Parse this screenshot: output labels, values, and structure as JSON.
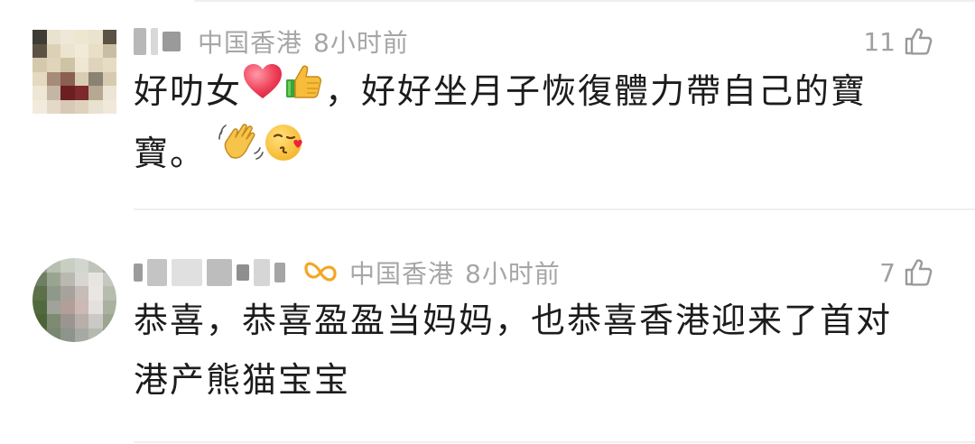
{
  "comments": [
    {
      "location": "中国香港",
      "time": "8小时前",
      "likes": "11",
      "text_line_1": "好叻女",
      "text_line_2": "，好好坐月子恢復體力帶自己的寶",
      "text_line_3": "寶。",
      "emojis": [
        "red-heart",
        "thumbs-up",
        "waving-hand",
        "face-blowing-kiss"
      ]
    },
    {
      "location": "中国香港",
      "time": "8小时前",
      "likes": "7",
      "badge_icon": "orange-infinity-badge-icon",
      "text": "恭喜，恭喜盈盈当妈妈，也恭喜香港迎来了首对港产熊猫宝宝"
    }
  ],
  "colors": {
    "meta_gray": "#a6a6a6",
    "text": "#1c1c1c",
    "divider": "#efefef",
    "badge_orange": "#f5a623"
  }
}
